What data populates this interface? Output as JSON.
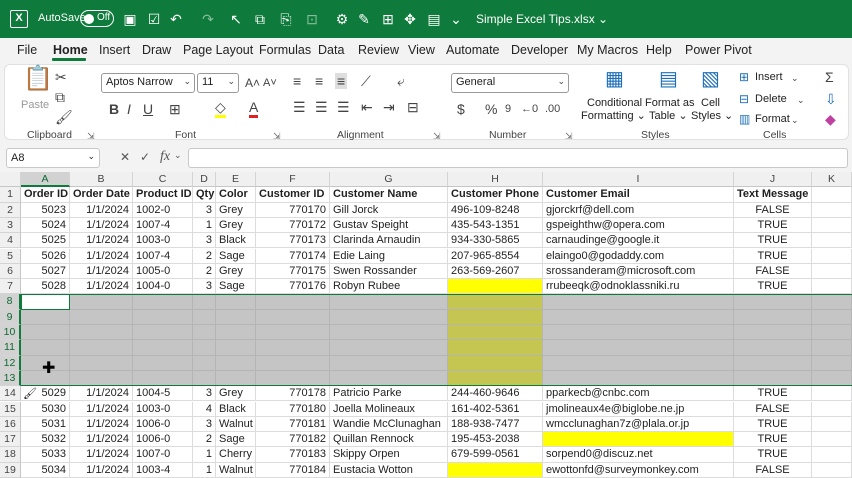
{
  "titlebar": {
    "autosave_label": "AutoSave",
    "toggle_state": "Off",
    "filename": "Simple Excel Tips.xlsx",
    "filename_arrow": "⌄"
  },
  "menus": [
    "File",
    "Home",
    "Insert",
    "Draw",
    "Page Layout",
    "Formulas",
    "Data",
    "Review",
    "View",
    "Automate",
    "Developer",
    "My Macros",
    "Help",
    "Power Pivot"
  ],
  "ribbon": {
    "clipboard": {
      "paste": "Paste",
      "group": "Clipboard"
    },
    "font": {
      "name": "Aptos Narrow",
      "size": "11",
      "group": "Font"
    },
    "alignment": {
      "group": "Alignment"
    },
    "number": {
      "format": "General",
      "group": "Number"
    },
    "styles": {
      "conditional": [
        "Conditional",
        "Formatting ⌄"
      ],
      "format_as_table": [
        "Format as",
        "Table ⌄"
      ],
      "cell_styles": [
        "Cell",
        "Styles ⌄"
      ],
      "group": "Styles"
    },
    "cells": {
      "insert": "Insert",
      "delete": "Delete",
      "format": "Format",
      "group": "Cells"
    }
  },
  "formula_bar": {
    "name_box": "A8",
    "fx": "fx",
    "value": ""
  },
  "columns": [
    "A",
    "B",
    "C",
    "D",
    "E",
    "F",
    "G",
    "H",
    "I",
    "J",
    "K"
  ],
  "row_numbers": [
    "1",
    "2",
    "3",
    "4",
    "5",
    "6",
    "7",
    "8",
    "9",
    "10",
    "11",
    "12",
    "13",
    "14",
    "15",
    "16",
    "17",
    "18",
    "19"
  ],
  "rows": [
    [
      "Order ID",
      "Order Date",
      "Product ID",
      "Qty",
      "Color",
      "Customer ID",
      "Customer Name",
      "Customer Phone",
      "Customer Email",
      "Text Message",
      ""
    ],
    [
      "5023",
      "1/1/2024",
      "1002-0",
      "3",
      "Grey",
      "770170",
      "Gill Jorck",
      "496-109-8248",
      "gjorckrf@dell.com",
      "FALSE",
      ""
    ],
    [
      "5024",
      "1/1/2024",
      "1007-4",
      "1",
      "Grey",
      "770172",
      "Gustav Speight",
      "435-543-1351",
      "gspeighthw@opera.com",
      "TRUE",
      ""
    ],
    [
      "5025",
      "1/1/2024",
      "1003-0",
      "3",
      "Black",
      "770173",
      "Clarinda Arnaudin",
      "934-330-5865",
      "carnaudinge@google.it",
      "TRUE",
      ""
    ],
    [
      "5026",
      "1/1/2024",
      "1007-4",
      "2",
      "Sage",
      "770174",
      "Edie Laing",
      "207-965-8554",
      "elaingo0@godaddy.com",
      "TRUE",
      ""
    ],
    [
      "5027",
      "1/1/2024",
      "1005-0",
      "2",
      "Grey",
      "770175",
      "Swen Rossander",
      "263-569-2607",
      "srossanderam@microsoft.com",
      "FALSE",
      ""
    ],
    [
      "5028",
      "1/1/2024",
      "1004-0",
      "3",
      "Sage",
      "770176",
      "Robyn Rubee",
      "",
      "rrubeeqk@odnoklassniki.ru",
      "TRUE",
      ""
    ],
    [
      "",
      "",
      "",
      "",
      "",
      "",
      "",
      "",
      "",
      "",
      ""
    ],
    [
      "",
      "",
      "",
      "",
      "",
      "",
      "",
      "",
      "",
      "",
      ""
    ],
    [
      "",
      "",
      "",
      "",
      "",
      "",
      "",
      "",
      "",
      "",
      ""
    ],
    [
      "",
      "",
      "",
      "",
      "",
      "",
      "",
      "",
      "",
      "",
      ""
    ],
    [
      "",
      "",
      "",
      "",
      "",
      "",
      "",
      "",
      "",
      "",
      ""
    ],
    [
      "",
      "",
      "",
      "",
      "",
      "",
      "",
      "",
      "",
      "",
      ""
    ],
    [
      "5029",
      "1/1/2024",
      "1004-5",
      "3",
      "Grey",
      "770178",
      "Patricio Parke",
      "244-460-9646",
      "pparkecb@cnbc.com",
      "TRUE",
      ""
    ],
    [
      "5030",
      "1/1/2024",
      "1003-0",
      "4",
      "Black",
      "770180",
      "Joella Molineaux",
      "161-402-5361",
      "jmolineaux4e@biglobe.ne.jp",
      "FALSE",
      ""
    ],
    [
      "5031",
      "1/1/2024",
      "1006-0",
      "3",
      "Walnut",
      "770181",
      "Wandie McClunaghan",
      "188-938-7477",
      "wmcclunaghan7z@plala.or.jp",
      "TRUE",
      ""
    ],
    [
      "5032",
      "1/1/2024",
      "1006-0",
      "2",
      "Sage",
      "770182",
      "Quillan Rennock",
      "195-453-2038",
      "",
      "TRUE",
      ""
    ],
    [
      "5033",
      "1/1/2024",
      "1007-0",
      "1",
      "Cherry",
      "770183",
      "Skippy Orpen",
      "679-599-0561",
      "sorpend0@discuz.net",
      "TRUE",
      ""
    ],
    [
      "5034",
      "1/1/2024",
      "1003-4",
      "1",
      "Walnut",
      "770184",
      "Eustacia Wotton",
      "",
      "ewottonfd@surveymonkey.com",
      "FALSE",
      ""
    ]
  ],
  "colors": {
    "brand": "#0e7a3b",
    "highlight": "#ffff00",
    "selection": "#a6a6a6"
  }
}
